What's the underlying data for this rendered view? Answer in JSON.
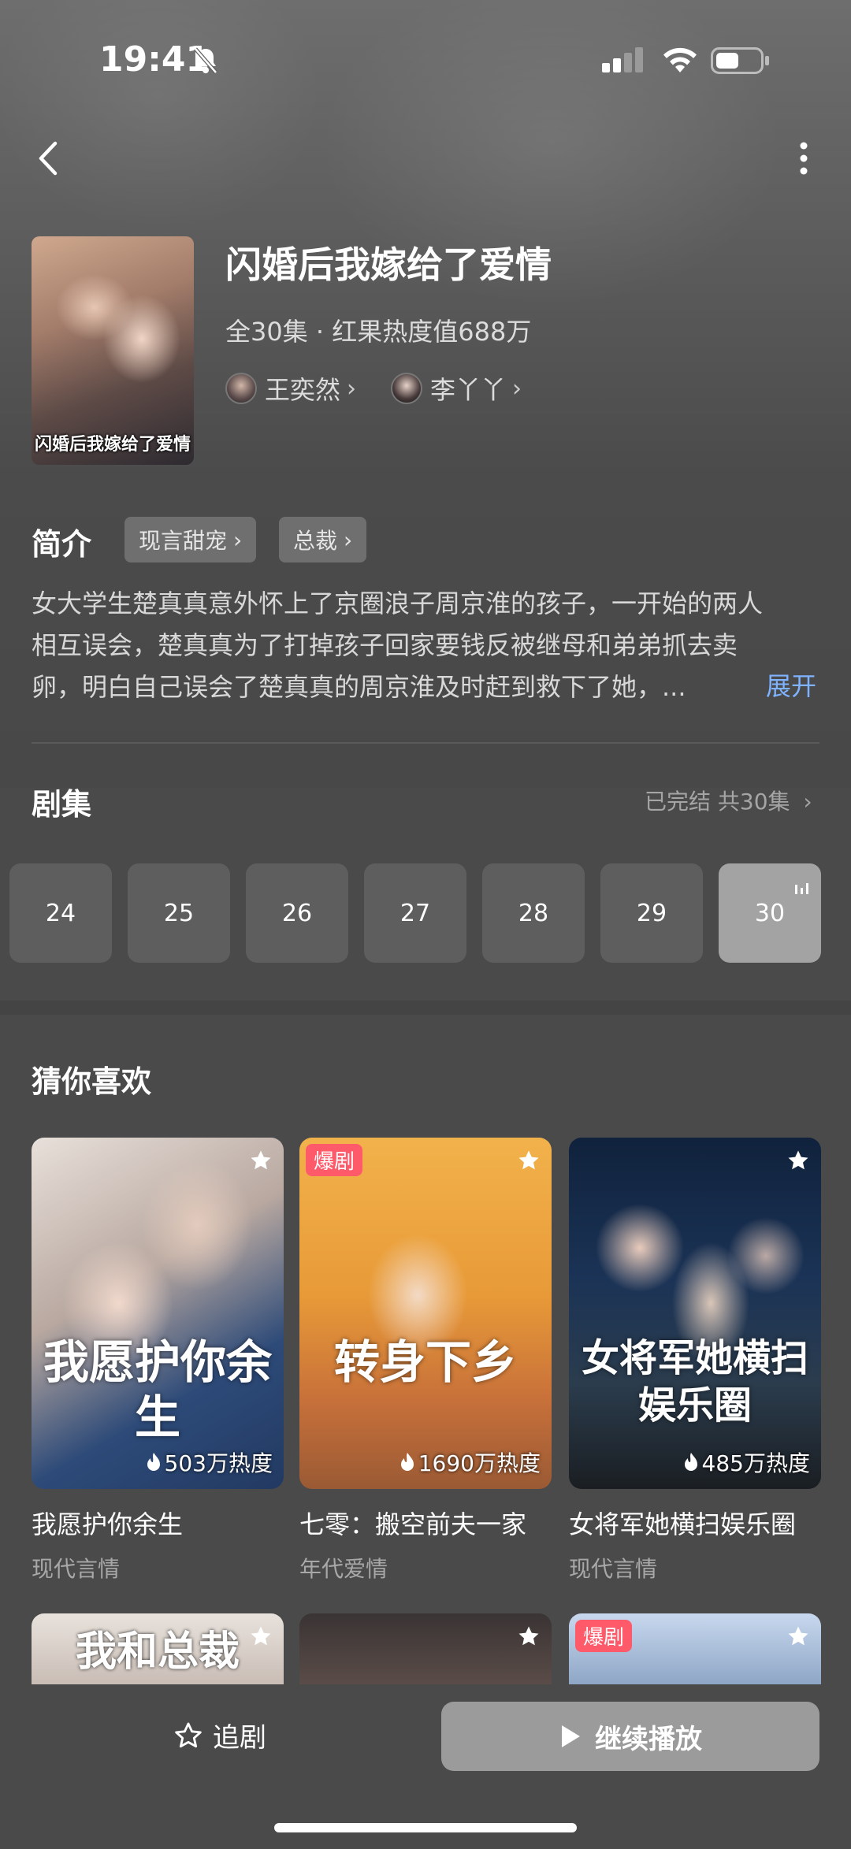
{
  "status_bar": {
    "time": "19:41"
  },
  "drama": {
    "title": "闪婚后我嫁给了爱情",
    "poster_text": "闪婚后我嫁给了爱情",
    "meta": "全30集 · 红果热度值688万",
    "actors": [
      {
        "name": "王奕然"
      },
      {
        "name": "李丫丫"
      }
    ]
  },
  "intro": {
    "label": "简介",
    "tags": [
      "现言甜宠",
      "总裁"
    ],
    "lines": [
      "女大学生楚真真意外怀上了京圈浪子周京淮的孩子，一开始的两人",
      "相互误会，楚真真为了打掉孩子回家要钱反被继母和弟弟抓去卖",
      "卵，明白自己误会了楚真真的周京淮及时赶到救下了她，..."
    ],
    "expand": "展开"
  },
  "episodes": {
    "label": "剧集",
    "status": "已完结 共30集",
    "items": [
      "24",
      "25",
      "26",
      "27",
      "28",
      "29",
      "30"
    ],
    "current": "30"
  },
  "recommend": {
    "label": "猜你喜欢",
    "cards": [
      {
        "name": "我愿护你余生",
        "genre": "现代言情",
        "heat": "503万热度",
        "cover_text": "我愿护你余生",
        "badge": ""
      },
      {
        "name": "七零：搬空前夫一家",
        "genre": "年代爱情",
        "heat": "1690万热度",
        "cover_text": "转身下乡",
        "badge": "爆剧"
      },
      {
        "name": "女将军她横扫娱乐圈",
        "genre": "现代言情",
        "heat": "485万热度",
        "cover_text": "女将军她横扫娱乐圈",
        "badge": ""
      }
    ],
    "row2_first_title": "我和总裁",
    "row2_badge": "爆剧"
  },
  "bottom": {
    "follow_label": "追剧",
    "play_label": "继续播放"
  }
}
